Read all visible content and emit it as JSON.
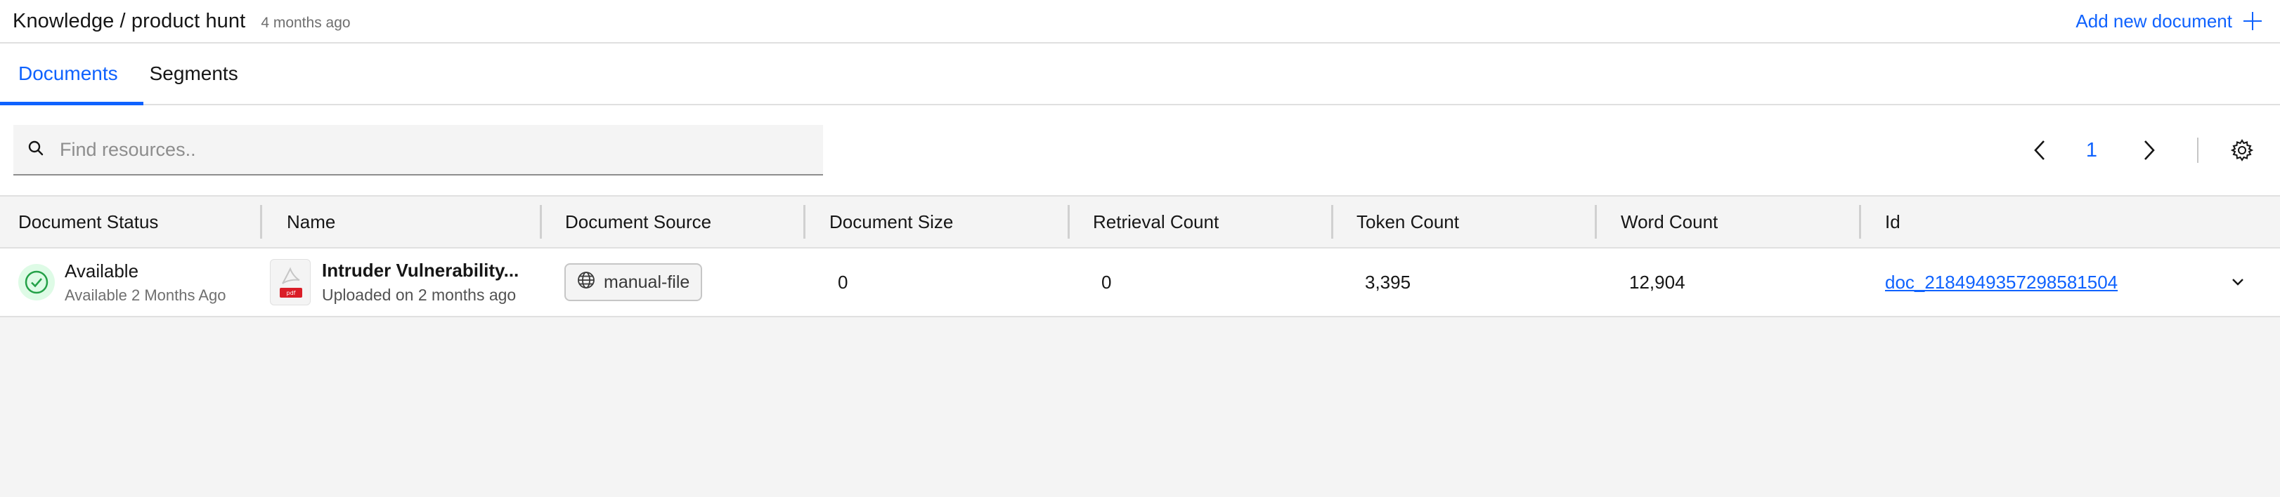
{
  "header": {
    "breadcrumb": "Knowledge / product hunt",
    "timestamp": "4 months ago",
    "add_document_label": "Add new document"
  },
  "tabs": [
    {
      "label": "Documents",
      "active": true
    },
    {
      "label": "Segments",
      "active": false
    }
  ],
  "search": {
    "placeholder": "Find resources.."
  },
  "pagination": {
    "current_page": "1"
  },
  "table": {
    "columns": [
      "Document Status",
      "Name",
      "Document Source",
      "Document Size",
      "Retrieval Count",
      "Token Count",
      "Word Count",
      "Id"
    ],
    "rows": [
      {
        "status": "Available",
        "status_sub": "Available 2 Months Ago",
        "name": "Intruder Vulnerability...",
        "name_sub": "Uploaded on 2 months ago",
        "file_badge": "pdf",
        "source": "manual-file",
        "size": "0",
        "retrieval_count": "0",
        "token_count": "3,395",
        "word_count": "12,904",
        "id": "doc_2184949357298581504"
      }
    ]
  },
  "colors": {
    "accent": "#0f62fe",
    "success": "#24a148",
    "success_bg": "#defbe6",
    "pdf_red": "#da1e28"
  },
  "icons": {
    "add": "plus-icon",
    "search": "search-icon",
    "prev": "chevron-left-icon",
    "next": "chevron-right-icon",
    "settings": "gear-icon",
    "status": "check-circle-icon",
    "file": "pdf-file-icon",
    "source": "globe-icon",
    "expand": "chevron-down-icon"
  }
}
